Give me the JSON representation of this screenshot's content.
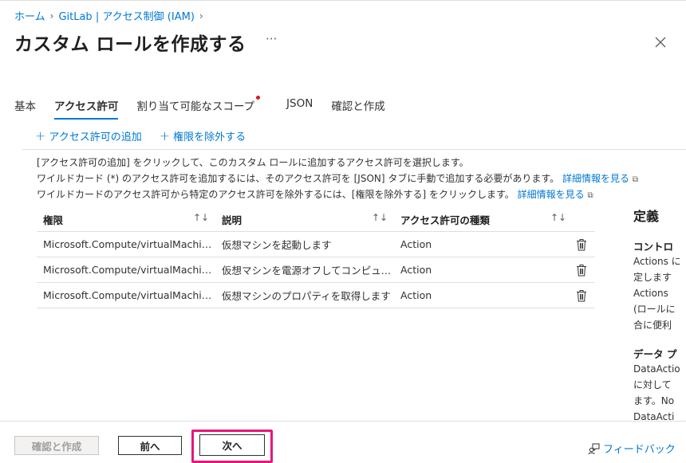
{
  "breadcrumb": {
    "home": "ホーム",
    "current": "GitLab | アクセス制御 (IAM)"
  },
  "page": {
    "title": "カスタム ロールを作成する",
    "more": "···"
  },
  "tabs": [
    {
      "label": "基本"
    },
    {
      "label": "アクセス許可"
    },
    {
      "label": "割り当て可能なスコープ"
    },
    {
      "label": "JSON"
    },
    {
      "label": "確認と作成"
    }
  ],
  "toolbar": {
    "add_label": "アクセス許可の追加",
    "remove_label": "権限を除外する"
  },
  "info": {
    "line1": "[アクセス許可の追加] をクリックして、このカスタム ロールに追加するアクセス許可を選択します。",
    "line2": "ワイルドカード (*) のアクセス許可を追加するには、そのアクセス許可を [JSON] タブに手動で追加する必要があります。",
    "line3": "ワイルドカードのアクセス許可から特定のアクセス許可を除外するには、[権限を除外する] をクリックします。",
    "learn_more": "詳細情報を見る"
  },
  "table": {
    "headers": {
      "permission": "権限",
      "description": "説明",
      "type": "アクセス許可の種類"
    },
    "rows": [
      {
        "permission": "Microsoft.Compute/virtualMachines/start/action",
        "description": "仮想マシンを起動します",
        "type": "Action"
      },
      {
        "permission": "Microsoft.Compute/virtualMachines/powerOff/action",
        "description": "仮想マシンを電源オフしてコンピューティング",
        "type": "Action"
      },
      {
        "permission": "Microsoft.Compute/virtualMachines/read",
        "description": "仮想マシンのプロパティを取得します",
        "type": "Action"
      }
    ]
  },
  "side_panel": {
    "title": "定義",
    "control_title": "コントロ",
    "control_text": [
      "Actions に",
      "定します",
      "Actions ",
      "(ロールに",
      "合に便利"
    ],
    "data_title": "データ プ",
    "data_text": [
      "DataActio",
      "に対して",
      "ます。No",
      "DataActi"
    ]
  },
  "footer": {
    "review_label": "確認と作成",
    "prev_label": "前へ",
    "next_label": "次へ",
    "feedback_label": "フィードバック"
  },
  "colors": {
    "accent": "#0078d4",
    "highlight": "#e6177a",
    "required_dot": "#e81123"
  }
}
